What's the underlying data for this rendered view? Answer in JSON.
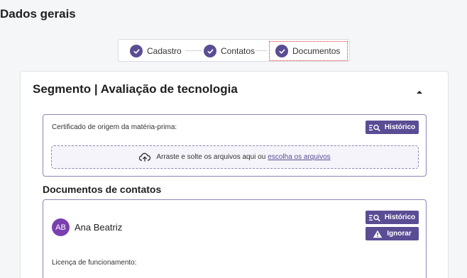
{
  "page": {
    "title": "Dados gerais"
  },
  "stepper": {
    "steps": [
      {
        "label": "Cadastro",
        "status": "done"
      },
      {
        "label": "Contatos",
        "status": "done"
      },
      {
        "label": "Documentos",
        "status": "done-active"
      }
    ]
  },
  "section": {
    "title": "Segmento | Avaliação de tecnologia",
    "collapse_icon": "caret-up-icon"
  },
  "certificate": {
    "label": "Certificado de origem da matéria-prima:",
    "history_button": "Histórico",
    "dropzone": {
      "text": "Arraste e solte os arquivos aqui ou",
      "link": "escolha os arquivos",
      "icon": "cloud-upload-icon"
    }
  },
  "contacts": {
    "title": "Documentos de contatos",
    "items": [
      {
        "initials": "AB",
        "name": "Ana Beatriz",
        "history_button": "Histórico",
        "ignore_button": "Ignorar",
        "document_label": "Licença de funcionamento:"
      }
    ]
  },
  "colors": {
    "accent": "#5a4d94",
    "avatar": "#7b3fb0",
    "active_outline": "#d32f2f"
  }
}
